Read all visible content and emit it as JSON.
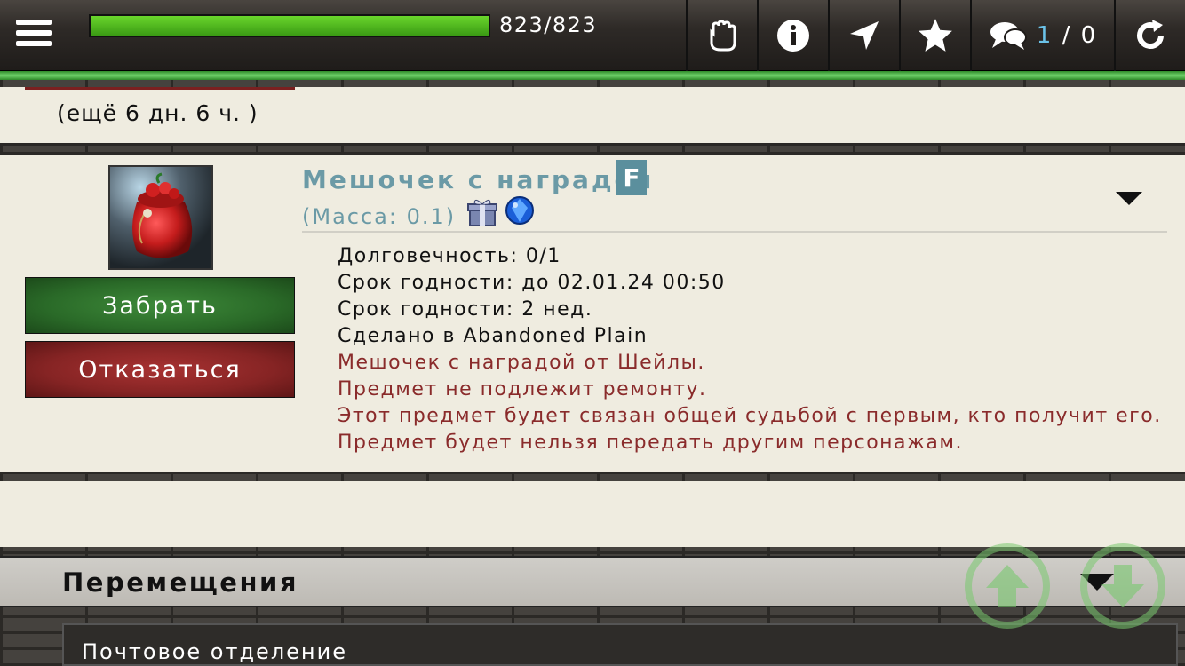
{
  "header": {
    "hp_value": "823/823",
    "hp_fraction": 1.0,
    "chat_unread": "1",
    "chat_sep": "/",
    "chat_total": "0",
    "icons": [
      "menu-icon",
      "hand-icon",
      "info-icon",
      "navigate-icon",
      "star-icon",
      "chat-icon",
      "refresh-icon"
    ]
  },
  "timer": {
    "text": "(ещё 6 дн. 6 ч. )"
  },
  "item": {
    "title": "Мешочек с наградой",
    "badge": "F",
    "mass": "(Масса: 0.1)",
    "take_label": "Забрать",
    "refuse_label": "Отказаться",
    "properties": [
      "Долговечность: 0/1",
      "Срок годности: до 02.01.24 00:50",
      "Срок годности: 2 нед.",
      "Сделано в Abandoned Plain"
    ],
    "notes": [
      "Мешочек с наградой от Шейлы.",
      "Предмет не подлежит ремонту.",
      "Этот предмет будет связан общей судьбой с первым, кто получит его.",
      "Предмет будет нельзя передать другим персонажам."
    ],
    "colors": {
      "title": "#6b9aa6",
      "note": "#8a2b2b",
      "take": "#2a6a28",
      "refuse": "#862424"
    }
  },
  "movement": {
    "title": "Перемещения",
    "post_office": "Почтовое отделение"
  }
}
